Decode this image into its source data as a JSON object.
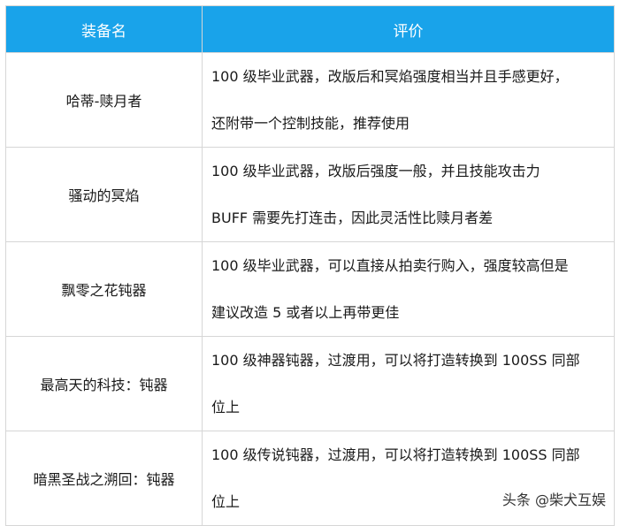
{
  "table": {
    "headers": [
      "装备名",
      "评价"
    ],
    "rows": [
      {
        "name": "哈蒂-赎月者",
        "eval_line1": "100 级毕业武器，改版后和冥焰强度相当并且手感更好，",
        "eval_line2": "还附带一个控制技能，推荐使用"
      },
      {
        "name": "骚动的冥焰",
        "eval_line1": "100 级毕业武器，改版后强度一般，并且技能攻击力",
        "eval_line2": "BUFF 需要先打连击，因此灵活性比赎月者差"
      },
      {
        "name": "飘零之花钝器",
        "eval_line1": "100 级毕业武器，可以直接从拍卖行购入，强度较高但是",
        "eval_line2": "建议改造 5 或者以上再带更佳"
      },
      {
        "name": "最高天的科技：钝器",
        "eval_line1": "100 级神器钝器，过渡用，可以将打造转换到 100SS 同部",
        "eval_line2": "位上"
      },
      {
        "name": "暗黑圣战之溯回：钝器",
        "eval_line1": "100 级传说钝器，过渡用，可以将打造转换到 100SS 同部",
        "eval_line2": "位上"
      }
    ]
  },
  "watermark": "头条 @柴犬互娱"
}
